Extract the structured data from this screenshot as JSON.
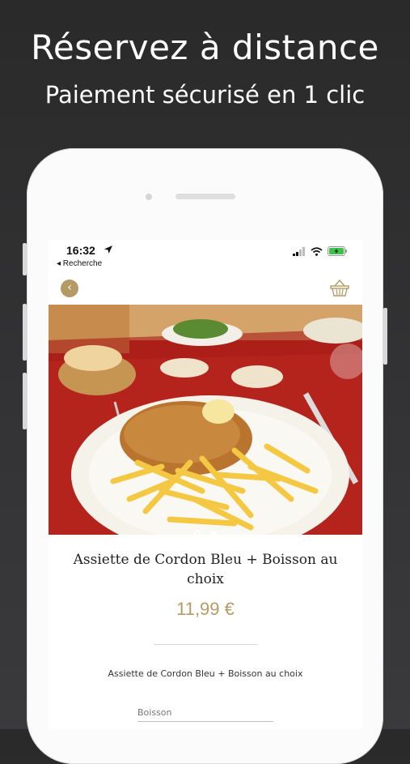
{
  "promo": {
    "headline": "Réservez à distance",
    "subline": "Paiement sécurisé en 1 clic"
  },
  "status_bar": {
    "time": "16:32",
    "back_app": "◂ Recherche",
    "icons": [
      "location-arrow-icon",
      "signal-icon",
      "wifi-icon",
      "battery-charging-icon"
    ]
  },
  "nav": {
    "back_icon": "chevron-left-icon",
    "back_glyph": "‹",
    "basket_icon": "basket-icon"
  },
  "product": {
    "image_alt": "photo-cordon-bleu-fries",
    "carousel_dots": 2,
    "carousel_active": 1,
    "title": "Assiette de Cordon Bleu + Boisson au choix",
    "price": "11,99 €",
    "description": "Assiette de Cordon Bleu + Boisson au choix",
    "option_placeholder": "Boisson"
  },
  "colors": {
    "accent": "#b59a64",
    "background_dark": "#2e2e2f",
    "screen_bg": "#ffffff"
  }
}
